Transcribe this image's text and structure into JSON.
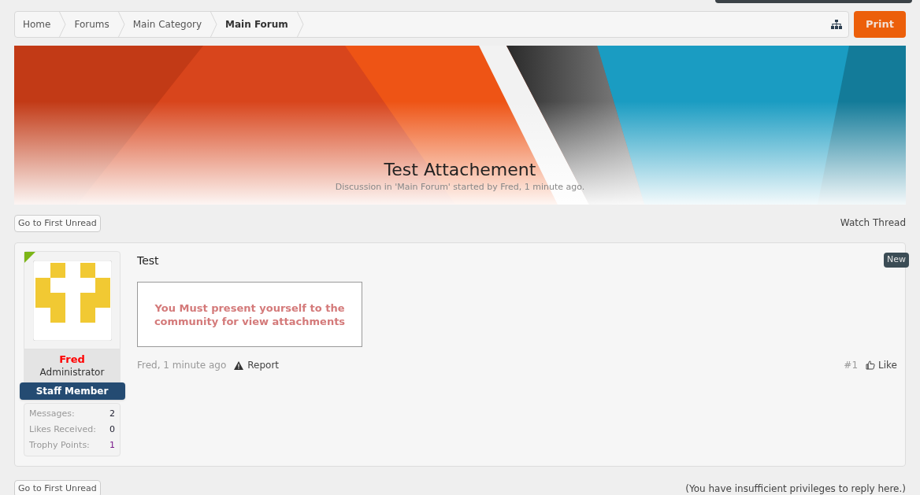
{
  "breadcrumb": [
    {
      "label": "Home",
      "selected": false
    },
    {
      "label": "Forums",
      "selected": false
    },
    {
      "label": "Main Category",
      "selected": false
    },
    {
      "label": "Main Forum",
      "selected": true
    }
  ],
  "print_button": "Print",
  "thread": {
    "title": "Test Attachement",
    "meta": "Discussion in 'Main Forum' started by Fred, 1 minute ago."
  },
  "top_controls": {
    "first_unread": "Go to First Unread",
    "watch": "Watch Thread"
  },
  "post": {
    "author": "Fred",
    "role": "Administrator",
    "banner": "Staff Member",
    "stats": [
      {
        "label": "Messages:",
        "value": "2"
      },
      {
        "label": "Likes Received:",
        "value": "0"
      },
      {
        "label": "Trophy Points:",
        "value": "1"
      }
    ],
    "title": "Test",
    "notice": "You Must present yourself to the community for view attachments",
    "byline": "Fred, 1 minute ago",
    "report": "Report",
    "number": "#1",
    "like": "Like",
    "new_badge": "New"
  },
  "bottom_controls": {
    "first_unread": "Go to First Unread",
    "privileges": "(You have insufficient privileges to reply here.)"
  }
}
